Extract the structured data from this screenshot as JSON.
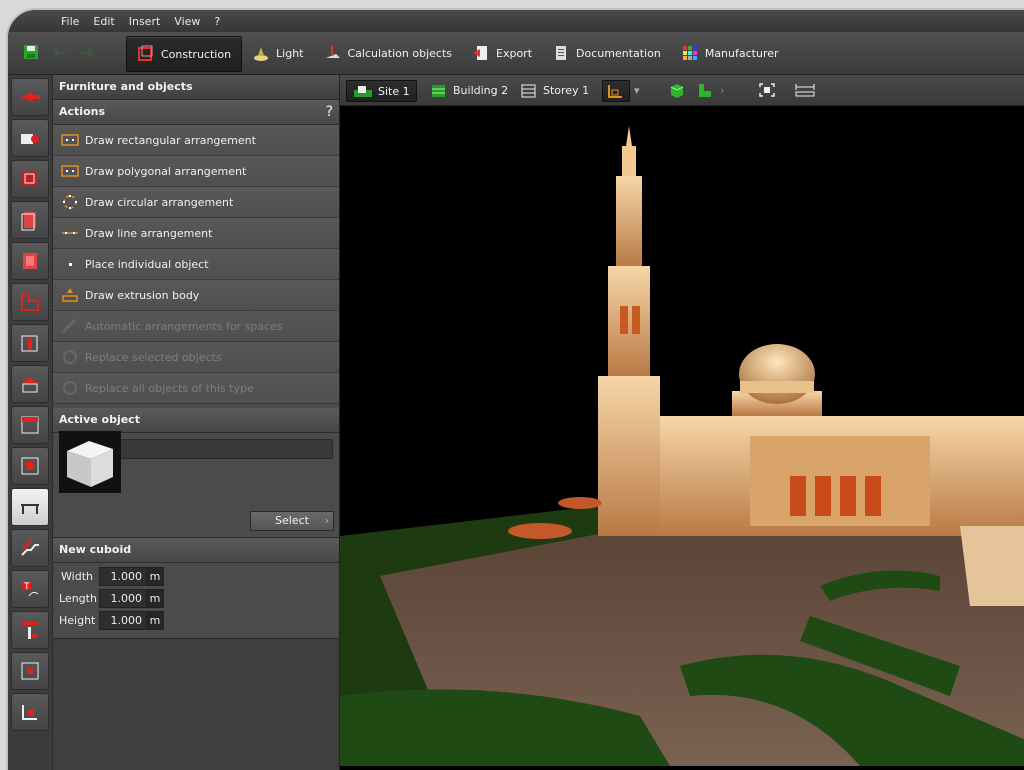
{
  "menu": [
    "File",
    "Edit",
    "Insert",
    "View",
    "?"
  ],
  "toolbar": {
    "tabs": [
      {
        "label": "Construction",
        "icon": "construction-icon",
        "active": true
      },
      {
        "label": "Light",
        "icon": "lamp-icon"
      },
      {
        "label": "Calculation objects",
        "icon": "calculation-icon"
      },
      {
        "label": "Export",
        "icon": "export-icon"
      },
      {
        "label": "Documentation",
        "icon": "documentation-icon"
      },
      {
        "label": "Manufacturer",
        "icon": "manufacturer-icon"
      }
    ]
  },
  "panel": {
    "title": "Furniture and objects",
    "actions_header": "Actions",
    "help": "?",
    "actions": [
      {
        "label": "Draw rectangular arrangement",
        "enabled": true
      },
      {
        "label": "Draw polygonal arrangement",
        "enabled": true
      },
      {
        "label": "Draw circular arrangement",
        "enabled": true
      },
      {
        "label": "Draw line arrangement",
        "enabled": true
      },
      {
        "label": "Place individual object",
        "enabled": true
      },
      {
        "label": "Draw extrusion body",
        "enabled": true
      },
      {
        "label": "Automatic arrangements for spaces",
        "enabled": false
      },
      {
        "label": "Replace selected objects",
        "enabled": false
      },
      {
        "label": "Replace all objects of this type",
        "enabled": false
      }
    ],
    "active_object_header": "Active object",
    "active_object_name": "Cube",
    "select_label": "Select",
    "new_cuboid_header": "New cuboid",
    "dims": [
      {
        "label": "Width",
        "value": "1.000",
        "unit": "m"
      },
      {
        "label": "Length",
        "value": "1.000",
        "unit": "m"
      },
      {
        "label": "Height",
        "value": "1.000",
        "unit": "m"
      }
    ]
  },
  "viewbar": {
    "site": "Site 1",
    "building": "Building 2",
    "storey": "Storey 1"
  },
  "colors": {
    "accent_red": "#c0262c",
    "accent_green": "#2db82d"
  }
}
